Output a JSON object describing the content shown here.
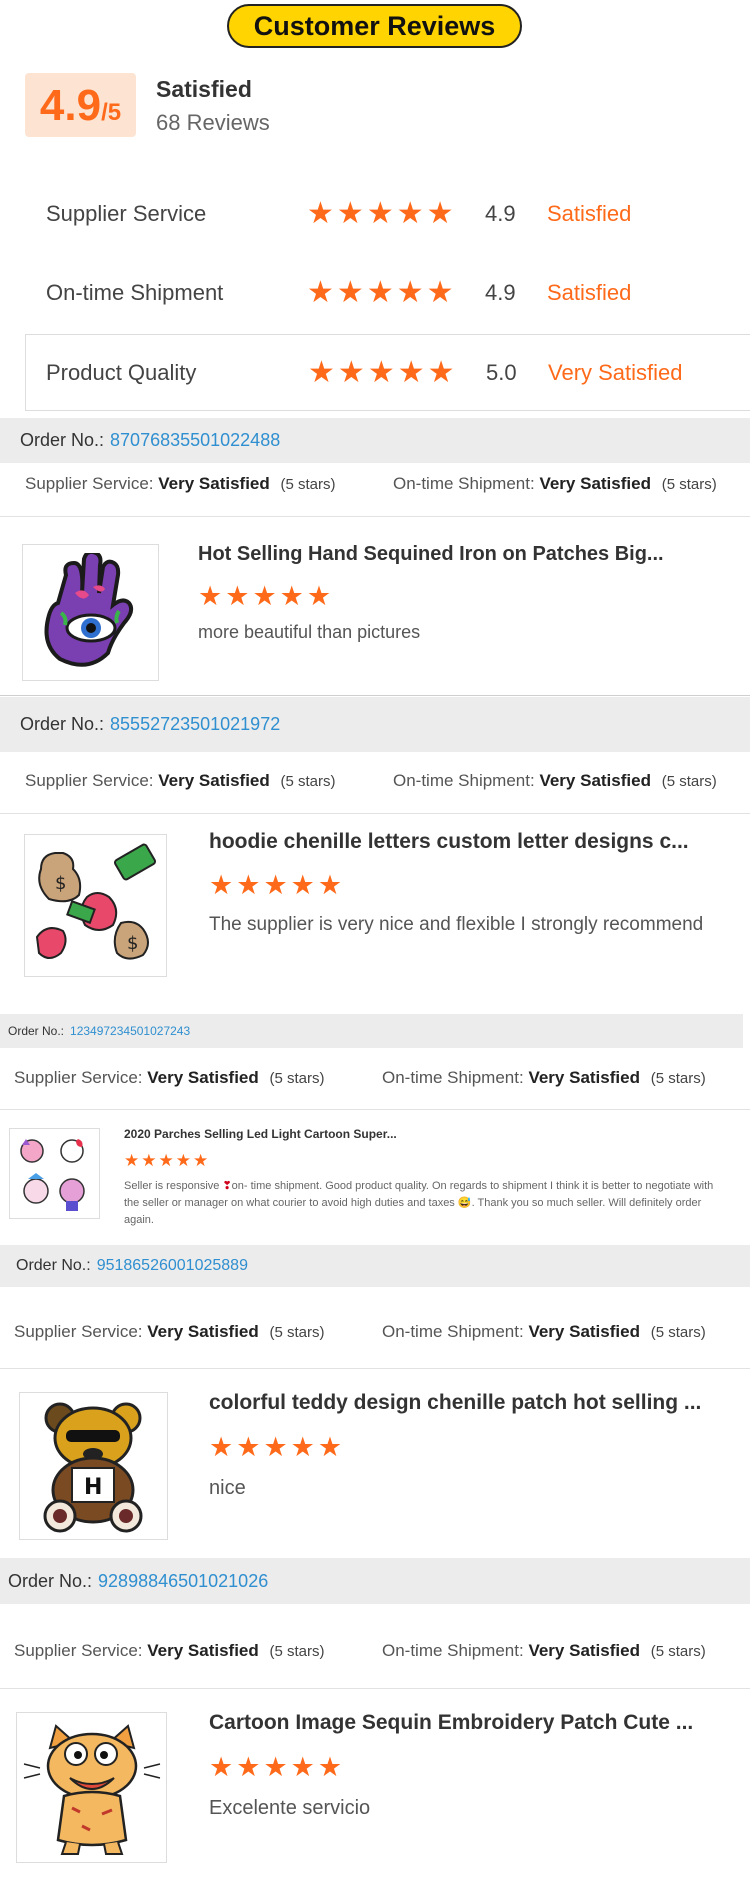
{
  "header": {
    "title": "Customer Reviews"
  },
  "summary": {
    "score": "4.9",
    "out_of": "/5",
    "label": "Satisfied",
    "count": "68 Reviews"
  },
  "metrics": [
    {
      "label": "Supplier Service",
      "score": "4.9",
      "text": "Satisfied",
      "stars": 5
    },
    {
      "label": "On-time Shipment",
      "score": "4.9",
      "text": "Satisfied",
      "stars": 5
    },
    {
      "label": "Product Quality",
      "score": "5.0",
      "text": "Very Satisfied",
      "stars": 5
    }
  ],
  "labels": {
    "order_no": "Order No.:",
    "supplier_service": "Supplier Service:",
    "ontime_shipment": "On-time Shipment:",
    "five_stars": "(5 stars)"
  },
  "reviews": [
    {
      "order_no": "87076835501022488",
      "supplier_rating": "Very Satisfied",
      "shipment_rating": "Very Satisfied",
      "product": "Hot Selling Hand Sequined Iron on Patches Big...",
      "stars": 5,
      "text": "more beautiful than pictures",
      "thumb_icon": "hamsa-hand-patch-icon"
    },
    {
      "order_no": "85552723501021972",
      "supplier_rating": "Very Satisfied",
      "shipment_rating": "Very Satisfied",
      "product": "hoodie chenille letters custom letter designs c...",
      "stars": 5,
      "text": "The supplier is very nice and flexible I strongly recommend",
      "thumb_icon": "money-bag-patches-icon"
    },
    {
      "order_no": "123497234501027243",
      "supplier_rating": "Very Satisfied",
      "shipment_rating": "Very Satisfied",
      "product": "2020 Parches Selling Led Light Cartoon Super...",
      "stars": 5,
      "text_before": "Seller is responsive ",
      "text_mid": "on- time shipment. Good product quality. On regards to shipment I think it is better to negotiate with the seller or manager on what courier to avoid high duties and taxes ",
      "text_after": ". Thank you so much seller. Will definitely order again.",
      "thumb_icon": "cartoon-patches-icon"
    },
    {
      "order_no": "95186526001025889",
      "supplier_rating": "Very Satisfied",
      "shipment_rating": "Very Satisfied",
      "product": "colorful teddy design chenille patch hot selling ...",
      "stars": 5,
      "text": "nice",
      "thumb_icon": "teddy-bear-patch-icon"
    },
    {
      "order_no": "92898846501021026",
      "supplier_rating": "Very Satisfied",
      "shipment_rating": "Very Satisfied",
      "product": "Cartoon Image Sequin Embroidery Patch Cute ...",
      "stars": 5,
      "text": "Excelente servicio",
      "thumb_icon": "cartoon-cat-patch-icon"
    }
  ],
  "colors": {
    "accent": "#ff6a1a",
    "link": "#2f8fd0",
    "header_pill": "#ffd400"
  }
}
